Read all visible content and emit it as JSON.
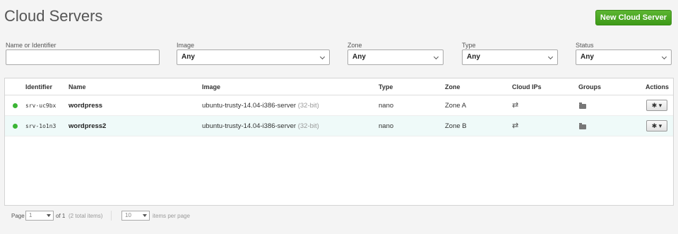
{
  "header": {
    "title": "Cloud Servers",
    "new_button": "New Cloud Server"
  },
  "filters": {
    "name": {
      "label": "Name or Identifier",
      "value": ""
    },
    "image": {
      "label": "Image",
      "value": "Any"
    },
    "zone": {
      "label": "Zone",
      "value": "Any"
    },
    "type": {
      "label": "Type",
      "value": "Any"
    },
    "status": {
      "label": "Status",
      "value": "Any"
    }
  },
  "table": {
    "columns": [
      "Identifier",
      "Name",
      "Image",
      "Type",
      "Zone",
      "Cloud IPs",
      "Groups",
      "Actions"
    ],
    "rows": [
      {
        "status_color": "#3ab534",
        "identifier": "srv-uc9bx",
        "name": "wordpress",
        "image": "ubuntu-trusty-14.04-i386-server",
        "arch": "(32-bit)",
        "type": "nano",
        "zone": "Zone A"
      },
      {
        "status_color": "#3ab534",
        "identifier": "srv-1o1n3",
        "name": "wordpress2",
        "image": "ubuntu-trusty-14.04-i386-server",
        "arch": "(32-bit)",
        "type": "nano",
        "zone": "Zone B"
      }
    ],
    "actions_glyph": "✱ ▾",
    "cloud_ip_icon": "shuffle-icon",
    "group_icon": "folder-icon"
  },
  "pagination": {
    "page_label": "Page",
    "page_value": "1",
    "of_label": "of 1",
    "total": "(2 total items)",
    "per_page_value": "10",
    "per_page_label": "items per page"
  },
  "colors": {
    "accent": "#4aa822",
    "status_active": "#3ab534",
    "row_alt": "#effaf9"
  }
}
